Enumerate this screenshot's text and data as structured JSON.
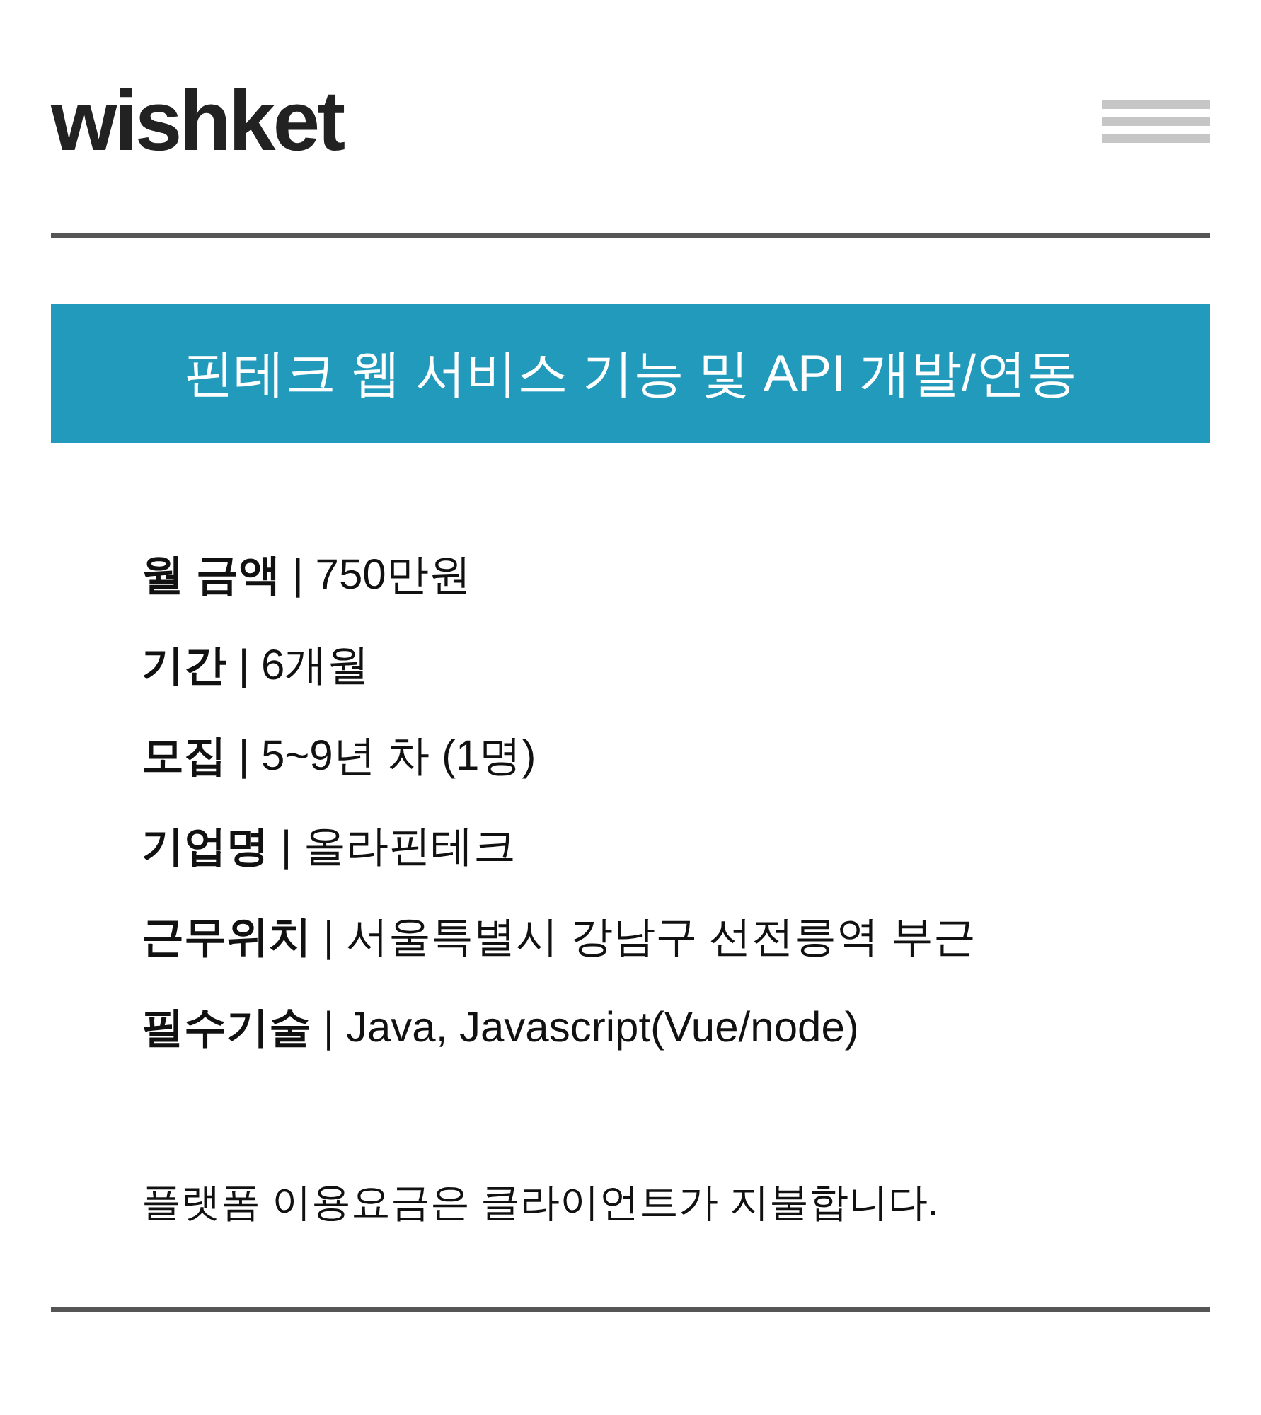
{
  "header": {
    "logo": "wishket"
  },
  "project": {
    "title": "핀테크 웹 서비스 기능 및 API 개발/연동"
  },
  "details": [
    "**월 금액** | 750만원",
    "**기간** | 6개월",
    "**모집** | 5~9년 차 (1명)",
    "**기업명** | 올라핀테크",
    "**근무위치** | 서울특별시 강남구 선전릉역 부근",
    "**필수기술** | Java, Javascript(Vue/node)"
  ],
  "notice": "플랫폼 이용요금은 클라이언트가 지불합니다."
}
